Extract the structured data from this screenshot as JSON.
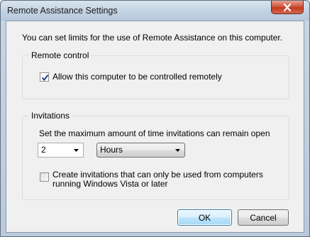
{
  "window": {
    "title": "Remote Assistance Settings"
  },
  "intro_text": "You can set limits for the use of Remote Assistance on this computer.",
  "remote_control": {
    "group_label": "Remote control",
    "allow_label": "Allow this computer to be controlled remotely",
    "allow_checked": true
  },
  "invitations": {
    "group_label": "Invitations",
    "description": "Set the maximum amount of time invitations can remain open",
    "amount_value": "2",
    "unit_value": "Hours",
    "vista_label": "Create invitations that can only be used from computers running Windows Vista or later",
    "vista_checked": false
  },
  "buttons": {
    "ok": "OK",
    "cancel": "Cancel"
  },
  "icons": {
    "close": "close-icon",
    "check": "checkmark-icon",
    "dropdown": "chevron-down-icon"
  }
}
